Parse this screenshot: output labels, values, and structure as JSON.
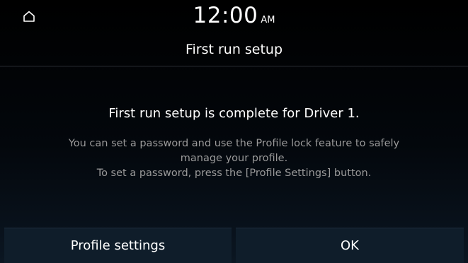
{
  "status_bar": {
    "home_icon": "home-icon",
    "time": "12:00",
    "ampm": "AM"
  },
  "header": {
    "title": "First run setup"
  },
  "message": {
    "main": "First run setup is complete for Driver 1.",
    "detail_lines": [
      "You can set a password and use the Profile lock feature to safely",
      "manage your profile.",
      "To set a password, press the [Profile Settings] button."
    ]
  },
  "buttons": {
    "profile_settings_label": "Profile settings",
    "ok_label": "OK"
  },
  "colors": {
    "background": "#000000",
    "text_primary": "#ffffff",
    "text_secondary": "#9a9a9a",
    "button_bg": "#0f1d2a"
  }
}
